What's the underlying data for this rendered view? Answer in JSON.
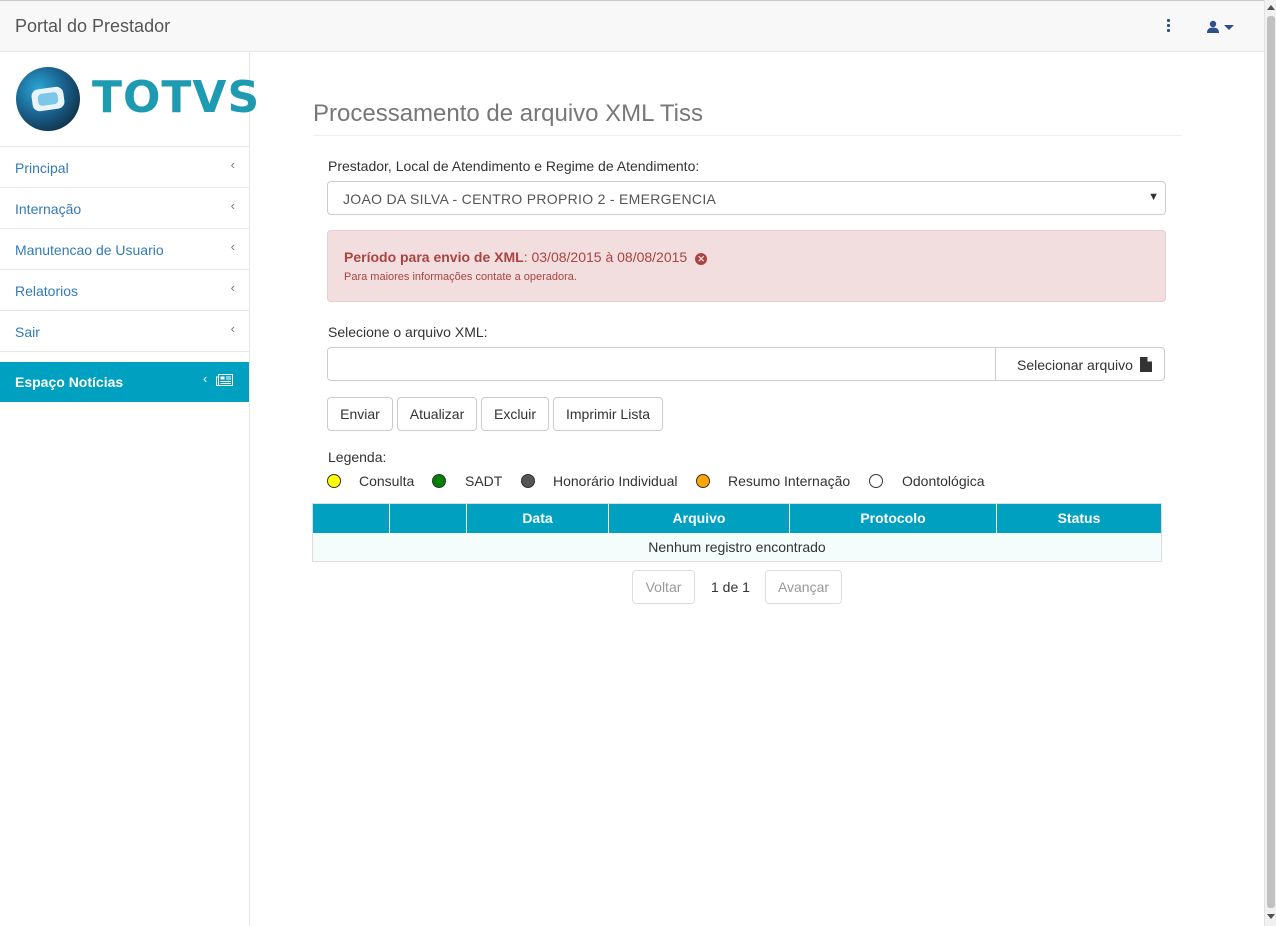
{
  "header": {
    "brand": "Portal do Prestador"
  },
  "logo": {
    "text": "TOTVS"
  },
  "sidebar": {
    "items": [
      {
        "label": "Principal"
      },
      {
        "label": "Internação"
      },
      {
        "label": "Manutencao de Usuario"
      },
      {
        "label": "Relatorios"
      },
      {
        "label": "Sair"
      }
    ],
    "news": {
      "label": "Espaço Notícias"
    },
    "chevron": "‹"
  },
  "main": {
    "title": "Processamento de arquivo XML Tiss",
    "prestador_label": "Prestador, Local de Atendimento e Regime de Atendimento:",
    "prestador_value": "JOAO DA SILVA - CENTRO PROPRIO 2 - EMERGENCIA",
    "alert": {
      "bold": "Período para envio de XML",
      "text": ": 03/08/2015 à 08/08/2015",
      "detail": "Para maiores informações contate a operadora."
    },
    "file_label": "Selecione o arquivo XML:",
    "file_value": "",
    "file_button": "Selecionar arquivo",
    "buttons": {
      "send": "Enviar",
      "refresh": "Atualizar",
      "delete": "Excluir",
      "print": "Imprimir Lista"
    },
    "legend": {
      "label": "Legenda:",
      "items": [
        {
          "label": "Consulta",
          "color": "#ffff00"
        },
        {
          "label": "SADT",
          "color": "#008000"
        },
        {
          "label": "Honorário Individual",
          "color": "#555555"
        },
        {
          "label": "Resumo Internação",
          "color": "#ffa500"
        },
        {
          "label": "Odontológica",
          "color": "#ffffff"
        }
      ]
    },
    "table": {
      "columns": [
        "",
        "",
        "Data",
        "Arquivo",
        "Protocolo",
        "Status"
      ],
      "empty": "Nenhum registro encontrado"
    },
    "pagination": {
      "prev": "Voltar",
      "info": "1 de 1",
      "next": "Avançar"
    }
  },
  "colors": {
    "accent": "#00a0c0",
    "alert_bg": "#f2dede",
    "alert_text": "#a94442",
    "link": "#337ab7"
  }
}
